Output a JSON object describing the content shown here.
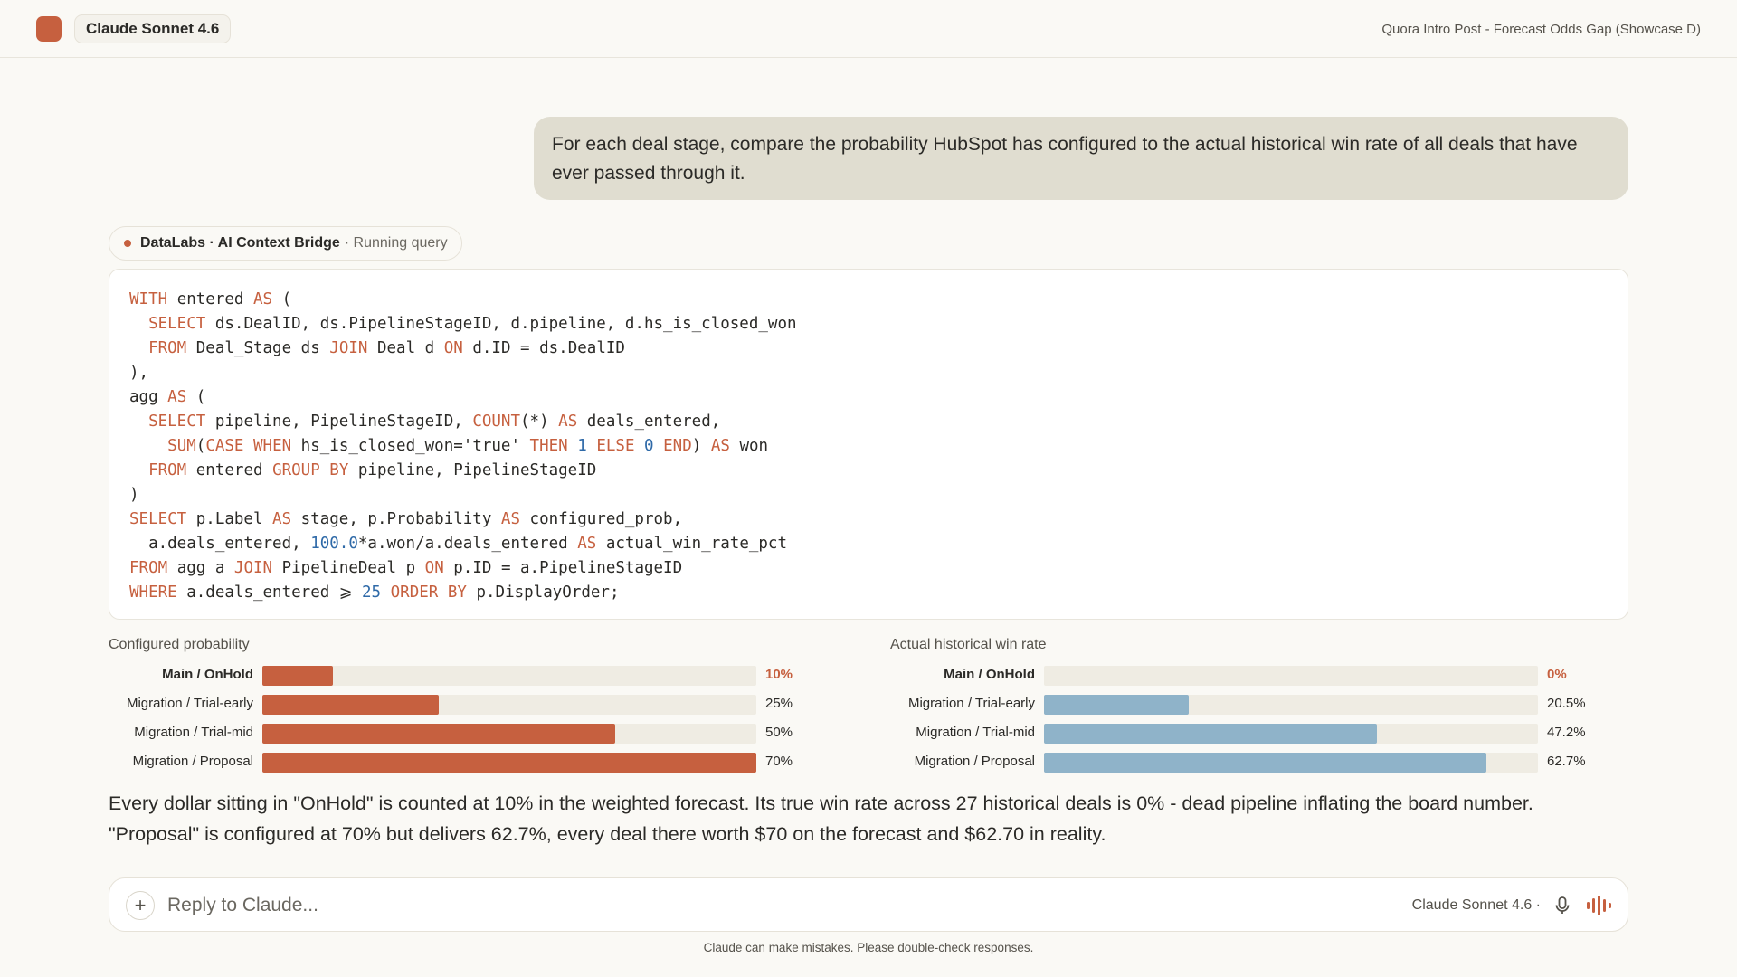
{
  "header": {
    "model_name": "Claude Sonnet 4.6",
    "chat_title": "Quora Intro Post - Forecast Odds Gap (Showcase D)"
  },
  "user_message": "For each deal stage, compare the probability HubSpot has configured to the actual historical win rate of all deals that have ever passed through it.",
  "tool": {
    "name": "DataLabs · AI Context Bridge",
    "status": "· Running query"
  },
  "code": {
    "lines": [
      [
        [
          "kw",
          "WITH"
        ],
        [
          "t",
          " entered "
        ],
        [
          "kw",
          "AS"
        ],
        [
          "t",
          " ("
        ]
      ],
      [
        [
          "t",
          "  "
        ],
        [
          "kw",
          "SELECT"
        ],
        [
          "t",
          " ds.DealID, ds.PipelineStageID, d.pipeline, d.hs_is_closed_won"
        ]
      ],
      [
        [
          "t",
          "  "
        ],
        [
          "kw",
          "FROM"
        ],
        [
          "t",
          " Deal_Stage ds "
        ],
        [
          "kw",
          "JOIN"
        ],
        [
          "t",
          " Deal d "
        ],
        [
          "kw",
          "ON"
        ],
        [
          "t",
          " d.ID = ds.DealID"
        ]
      ],
      [
        [
          "t",
          "),"
        ]
      ],
      [
        [
          "t",
          "agg "
        ],
        [
          "kw",
          "AS"
        ],
        [
          "t",
          " ("
        ]
      ],
      [
        [
          "t",
          "  "
        ],
        [
          "kw",
          "SELECT"
        ],
        [
          "t",
          " pipeline, PipelineStageID, "
        ],
        [
          "kw",
          "COUNT"
        ],
        [
          "t",
          "(*) "
        ],
        [
          "kw",
          "AS"
        ],
        [
          "t",
          " deals_entered,"
        ]
      ],
      [
        [
          "t",
          "    "
        ],
        [
          "kw",
          "SUM"
        ],
        [
          "t",
          "("
        ],
        [
          "kw",
          "CASE WHEN"
        ],
        [
          "t",
          " hs_is_closed_won='true' "
        ],
        [
          "kw",
          "THEN"
        ],
        [
          "t",
          " "
        ],
        [
          "num",
          "1"
        ],
        [
          "t",
          " "
        ],
        [
          "kw",
          "ELSE"
        ],
        [
          "t",
          " "
        ],
        [
          "num",
          "0"
        ],
        [
          "t",
          " "
        ],
        [
          "kw",
          "END"
        ],
        [
          "t",
          ") "
        ],
        [
          "kw",
          "AS"
        ],
        [
          "t",
          " won"
        ]
      ],
      [
        [
          "t",
          "  "
        ],
        [
          "kw",
          "FROM"
        ],
        [
          "t",
          " entered "
        ],
        [
          "kw",
          "GROUP BY"
        ],
        [
          "t",
          " pipeline, PipelineStageID"
        ]
      ],
      [
        [
          "t",
          ")"
        ]
      ],
      [
        [
          "kw",
          "SELECT"
        ],
        [
          "t",
          " p.Label "
        ],
        [
          "kw",
          "AS"
        ],
        [
          "t",
          " stage, p.Probability "
        ],
        [
          "kw",
          "AS"
        ],
        [
          "t",
          " configured_prob,"
        ]
      ],
      [
        [
          "t",
          "  a.deals_entered, "
        ],
        [
          "num",
          "100.0"
        ],
        [
          "t",
          "*a.won/a.deals_entered "
        ],
        [
          "kw",
          "AS"
        ],
        [
          "t",
          " actual_win_rate_pct"
        ]
      ],
      [
        [
          "kw",
          "FROM"
        ],
        [
          "t",
          " agg a "
        ],
        [
          "kw",
          "JOIN"
        ],
        [
          "t",
          " PipelineDeal p "
        ],
        [
          "kw",
          "ON"
        ],
        [
          "t",
          " p.ID = a.PipelineStageID"
        ]
      ],
      [
        [
          "kw",
          "WHERE"
        ],
        [
          "t",
          " a.deals_entered ⩾ "
        ],
        [
          "num",
          "25"
        ],
        [
          "t",
          " "
        ],
        [
          "kw",
          "ORDER BY"
        ],
        [
          "t",
          " p.DisplayOrder;"
        ]
      ]
    ]
  },
  "chart_data": [
    {
      "type": "bar",
      "title": "Configured probability",
      "categories": [
        "Main / OnHold",
        "Migration / Trial-early",
        "Migration / Trial-mid",
        "Migration / Proposal"
      ],
      "values": [
        10,
        25,
        50,
        70
      ],
      "value_labels": [
        "10%",
        "25%",
        "50%",
        "70%"
      ],
      "xlim": [
        0,
        70
      ],
      "color": "#c6603f",
      "highlight_category": "Main / OnHold"
    },
    {
      "type": "bar",
      "title": "Actual historical win rate",
      "categories": [
        "Main / OnHold",
        "Migration / Trial-early",
        "Migration / Trial-mid",
        "Migration / Proposal"
      ],
      "values": [
        0,
        20.5,
        47.2,
        62.7
      ],
      "value_labels": [
        "0%",
        "20.5%",
        "47.2%",
        "62.7%"
      ],
      "xlim": [
        0,
        70
      ],
      "color": "#8fb3c9",
      "highlight_category": "Main / OnHold"
    }
  ],
  "answer": "Every dollar sitting in \"OnHold\" is counted at 10% in the weighted forecast. Its true win rate across 27 historical deals is 0% - dead pipeline inflating the board number. \"Proposal\" is configured at 70% but delivers 62.7%, every deal there worth $70 on the forecast and $62.70 in reality.",
  "reply": {
    "placeholder": "Reply to Claude...",
    "model_label": "Claude Sonnet 4.6 ·"
  },
  "disclaimer": "Claude can make mistakes. Please double-check responses.",
  "colors": {
    "accent": "#c6603f",
    "actual_bar": "#8fb3c9",
    "track": "#efece3"
  }
}
